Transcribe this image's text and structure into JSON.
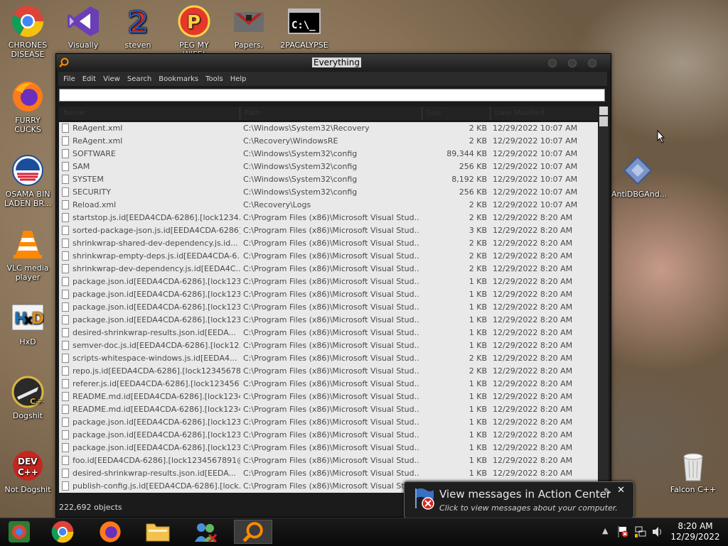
{
  "desktop": {
    "icons": [
      {
        "name": "chrome-icon",
        "label": "CHRONES DISEASE"
      },
      {
        "name": "visual-studio-icon",
        "label": "Visually"
      },
      {
        "name": "steven-icon",
        "label": "steven"
      },
      {
        "name": "peg-icon",
        "label": "PEG MY WIFE!"
      },
      {
        "name": "papers-icon",
        "label": "Papers,"
      },
      {
        "name": "cmd-icon",
        "label": "2PACALYPSE"
      },
      {
        "name": "firefox-icon",
        "label": "FURRY CUCKS"
      },
      {
        "name": "obama-logo-icon",
        "label": "OSAMA BIN LADEN BR..."
      },
      {
        "name": "vlc-icon",
        "label": "VLC media player"
      },
      {
        "name": "hxd-icon",
        "label": "HxD"
      },
      {
        "name": "codeblocks-icon",
        "label": "Dogshit"
      },
      {
        "name": "devcpp-icon",
        "label": "Not Dogshit"
      },
      {
        "name": "antidbg-icon",
        "label": "AntiDBGAnd..."
      },
      {
        "name": "recycle-bin-icon",
        "label": "Falcon C++"
      }
    ]
  },
  "window": {
    "title": "Everything",
    "menu": [
      "File",
      "Edit",
      "View",
      "Search",
      "Bookmarks",
      "Tools",
      "Help"
    ],
    "search_value": "",
    "columns": [
      "Name",
      "Path",
      "Size",
      "Date Modified"
    ],
    "rows": [
      [
        "ReAgent.xml",
        "C:\\Windows\\System32\\Recovery",
        "2 KB",
        "12/29/2022 10:07 AM"
      ],
      [
        "ReAgent.xml",
        "C:\\Recovery\\WindowsRE",
        "2 KB",
        "12/29/2022 10:07 AM"
      ],
      [
        "SOFTWARE",
        "C:\\Windows\\System32\\config",
        "89,344 KB",
        "12/29/2022 10:07 AM"
      ],
      [
        "SAM",
        "C:\\Windows\\System32\\config",
        "256 KB",
        "12/29/2022 10:07 AM"
      ],
      [
        "SYSTEM",
        "C:\\Windows\\System32\\config",
        "8,192 KB",
        "12/29/2022 10:07 AM"
      ],
      [
        "SECURITY",
        "C:\\Windows\\System32\\config",
        "256 KB",
        "12/29/2022 10:07 AM"
      ],
      [
        "Reload.xml",
        "C:\\Recovery\\Logs",
        "2 KB",
        "12/29/2022 10:07 AM"
      ],
      [
        "startstop.js.id[EEDA4CDA-6286].[lock1234...",
        "C:\\Program Files (x86)\\Microsoft Visual Stud...",
        "2 KB",
        "12/29/2022 8:20 AM"
      ],
      [
        "sorted-package-json.js.id[EEDA4CDA-6286]...",
        "C:\\Program Files (x86)\\Microsoft Visual Stud...",
        "3 KB",
        "12/29/2022 8:20 AM"
      ],
      [
        "shrinkwrap-shared-dev-dependency.js.id...",
        "C:\\Program Files (x86)\\Microsoft Visual Stud...",
        "2 KB",
        "12/29/2022 8:20 AM"
      ],
      [
        "shrinkwrap-empty-deps.js.id[EEDA4CDA-6...",
        "C:\\Program Files (x86)\\Microsoft Visual Stud...",
        "2 KB",
        "12/29/2022 8:20 AM"
      ],
      [
        "shrinkwrap-dev-dependency.js.id[EEDA4C...",
        "C:\\Program Files (x86)\\Microsoft Visual Stud...",
        "2 KB",
        "12/29/2022 8:20 AM"
      ],
      [
        "package.json.id[EEDA4CDA-6286].[lock123...",
        "C:\\Program Files (x86)\\Microsoft Visual Stud...",
        "1 KB",
        "12/29/2022 8:20 AM"
      ],
      [
        "package.json.id[EEDA4CDA-6286].[lock123...",
        "C:\\Program Files (x86)\\Microsoft Visual Stud...",
        "1 KB",
        "12/29/2022 8:20 AM"
      ],
      [
        "package.json.id[EEDA4CDA-6286].[lock123...",
        "C:\\Program Files (x86)\\Microsoft Visual Stud...",
        "1 KB",
        "12/29/2022 8:20 AM"
      ],
      [
        "package.json.id[EEDA4CDA-6286].[lock123...",
        "C:\\Program Files (x86)\\Microsoft Visual Stud...",
        "1 KB",
        "12/29/2022 8:20 AM"
      ],
      [
        "desired-shrinkwrap-results.json.id[EEDA...",
        "C:\\Program Files (x86)\\Microsoft Visual Stud...",
        "1 KB",
        "12/29/2022 8:20 AM"
      ],
      [
        "semver-doc.js.id[EEDA4CDA-6286].[lock12...",
        "C:\\Program Files (x86)\\Microsoft Visual Stud...",
        "1 KB",
        "12/29/2022 8:20 AM"
      ],
      [
        "scripts-whitespace-windows.js.id[EEDA4...",
        "C:\\Program Files (x86)\\Microsoft Visual Stud...",
        "2 KB",
        "12/29/2022 8:20 AM"
      ],
      [
        "repo.js.id[EEDA4CDA-6286].[lock12345678...",
        "C:\\Program Files (x86)\\Microsoft Visual Stud...",
        "2 KB",
        "12/29/2022 8:20 AM"
      ],
      [
        "referer.js.id[EEDA4CDA-6286].[lock1234567...",
        "C:\\Program Files (x86)\\Microsoft Visual Stud...",
        "1 KB",
        "12/29/2022 8:20 AM"
      ],
      [
        "README.md.id[EEDA4CDA-6286].[lock1234...",
        "C:\\Program Files (x86)\\Microsoft Visual Stud...",
        "1 KB",
        "12/29/2022 8:20 AM"
      ],
      [
        "README.md.id[EEDA4CDA-6286].[lock1234...",
        "C:\\Program Files (x86)\\Microsoft Visual Stud...",
        "1 KB",
        "12/29/2022 8:20 AM"
      ],
      [
        "package.json.id[EEDA4CDA-6286].[lock123...",
        "C:\\Program Files (x86)\\Microsoft Visual Stud...",
        "1 KB",
        "12/29/2022 8:20 AM"
      ],
      [
        "package.json.id[EEDA4CDA-6286].[lock123...",
        "C:\\Program Files (x86)\\Microsoft Visual Stud...",
        "1 KB",
        "12/29/2022 8:20 AM"
      ],
      [
        "package.json.id[EEDA4CDA-6286].[lock123...",
        "C:\\Program Files (x86)\\Microsoft Visual Stud...",
        "1 KB",
        "12/29/2022 8:20 AM"
      ],
      [
        "foo.id[EEDA4CDA-6286].[lock1234567891@...",
        "C:\\Program Files (x86)\\Microsoft Visual Stud...",
        "1 KB",
        "12/29/2022 8:20 AM"
      ],
      [
        "desired-shrinkwrap-results.json.id[EEDA...",
        "C:\\Program Files (x86)\\Microsoft Visual Stud...",
        "1 KB",
        "12/29/2022 8:20 AM"
      ],
      [
        "publish-config.js.id[EEDA4CDA-6286].[lock...",
        "C:\\Program Files (x86)\\Microsoft Visual Stud...",
        "1 KB",
        "12/29/2022 8:20 AM"
      ]
    ],
    "status": "222,692 objects"
  },
  "notification": {
    "title": "View messages in Action Center",
    "subtitle": "Click to view messages about your computer."
  },
  "clock": {
    "time": "8:20 AM",
    "date": "12/29/2022"
  },
  "colors": {
    "window_bg": "#1b1b1b",
    "list_bg": "#e9e9e9",
    "taskbar": "#0a0a0a"
  }
}
